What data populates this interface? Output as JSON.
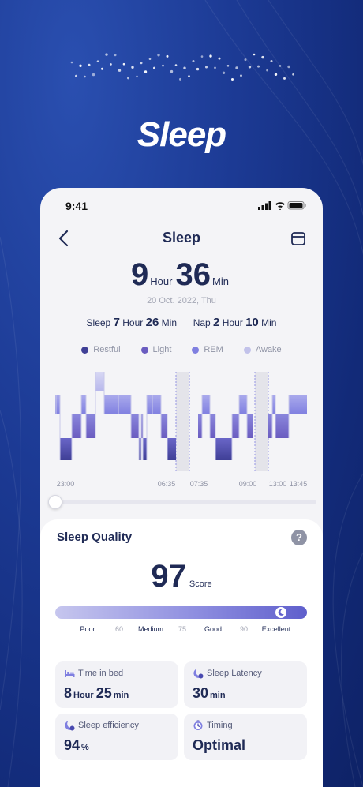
{
  "hero": {
    "title": "Sleep"
  },
  "status_bar": {
    "time": "9:41"
  },
  "nav": {
    "title": "Sleep",
    "back_icon": "chevron-left-icon",
    "calendar_icon": "calendar-icon"
  },
  "summary": {
    "hours": "9",
    "hour_unit": "Hour",
    "minutes": "36",
    "min_unit": "Min",
    "date": "20 Oct. 2022, Thu",
    "sleep_label": "Sleep",
    "sleep_hours": "7",
    "sleep_hour_unit": "Hour",
    "sleep_minutes": "26",
    "sleep_min_unit": "Min",
    "nap_label": "Nap",
    "nap_hours": "2",
    "nap_hour_unit": "Hour",
    "nap_minutes": "10",
    "nap_min_unit": "Min"
  },
  "legend": [
    {
      "label": "Restful",
      "color": "#3f3f96"
    },
    {
      "label": "Light",
      "color": "#6a5cc0"
    },
    {
      "label": "REM",
      "color": "#7f7fe0"
    },
    {
      "label": "Awake",
      "color": "#c2c2ea"
    }
  ],
  "chart_data": {
    "type": "area",
    "x_ticks": [
      "23:00",
      "06:35",
      "07:35",
      "09:00",
      "13:00",
      "13:45"
    ],
    "stages": [
      "Awake",
      "REM",
      "Light",
      "Restful"
    ],
    "gaps": [
      "06:35–07:35",
      "09:00–13:00"
    ]
  },
  "quality": {
    "title": "Sleep Quality",
    "help_label": "?",
    "score": "97",
    "score_label": "Score",
    "score_fraction": 0.97,
    "scale": [
      "Poor",
      "60",
      "Medium",
      "75",
      "Good",
      "90",
      "Excellent"
    ]
  },
  "metrics": [
    {
      "label": "Time in bed",
      "icon": "bed-icon",
      "v1": "8",
      "u1": "Hour",
      "v2": "25",
      "u2": "min"
    },
    {
      "label": "Sleep Latency",
      "icon": "moon-icon",
      "v1": "30",
      "u1": "min"
    },
    {
      "label": "Sleep efficiency",
      "icon": "moon-icon",
      "v1": "94",
      "u1": "%"
    },
    {
      "label": "Timing",
      "icon": "clock-icon",
      "v1": "Optimal"
    }
  ],
  "colors": {
    "accent": "#6a5cc0",
    "text": "#1f2a55",
    "background": "#1c3a94"
  }
}
